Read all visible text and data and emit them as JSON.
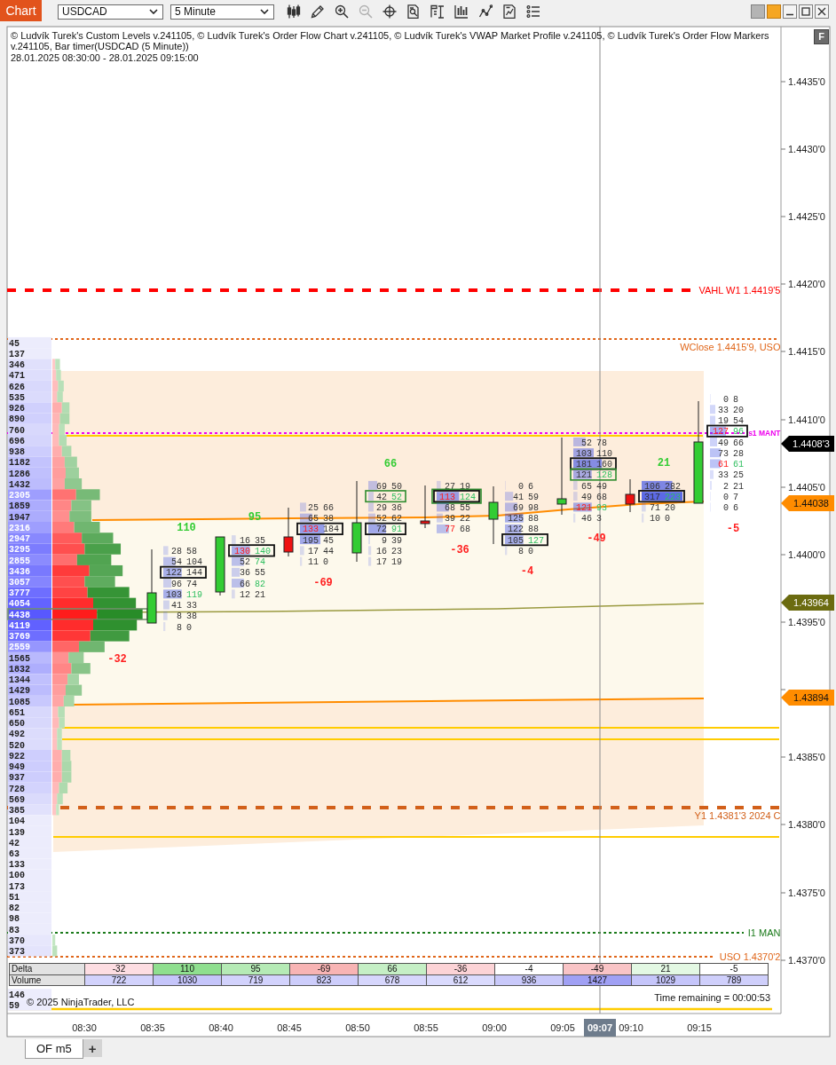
{
  "toolbar": {
    "title": "Chart",
    "instrument": "USDCAD",
    "interval": "5 Minute",
    "tools": [
      {
        "kind": "candlestick",
        "disabled": false
      },
      {
        "kind": "pencil",
        "disabled": false
      },
      {
        "kind": "zoom-in",
        "disabled": false
      },
      {
        "kind": "zoom-out",
        "disabled": true
      },
      {
        "kind": "crosshair",
        "disabled": false
      },
      {
        "kind": "search-document",
        "disabled": false
      },
      {
        "kind": "properties",
        "disabled": false
      },
      {
        "kind": "bars",
        "disabled": false
      },
      {
        "kind": "line",
        "disabled": false
      },
      {
        "kind": "document-chart",
        "disabled": false
      },
      {
        "kind": "list",
        "disabled": false
      }
    ]
  },
  "chart": {
    "header": "© Ludvík Turek's Custom Levels v.241105, © Ludvík Turek's Order Flow Chart v.241105, © Ludvík Turek's VWAP Market Profile v.241105, © Ludvík Turek's Order Flow Markers v.241105, Bar timer(USDCAD (5 Minute))",
    "date_range": "28.01.2025 08:30:00 - 28.01.2025 09:15:00",
    "f_button": "F",
    "price_axis": [
      "1.4435'0",
      "1.4430'0",
      "1.4425'0",
      "1.4420'0",
      "1.4415'0",
      "1.4410'0",
      "1.4405'0",
      "1.4400'0",
      "1.4395'0",
      "1.4385'0",
      "1.4380'0",
      "1.4375'0",
      "1.4370'0"
    ],
    "price_markers": [
      {
        "text": "1.4408'3",
        "color": "#000000"
      },
      {
        "text": "1.44038",
        "color": "#ff8c00"
      },
      {
        "text": "1.43964",
        "color": "#6b6b10"
      },
      {
        "text": "1.43894",
        "color": "#ff8c00"
      }
    ],
    "levels": [
      {
        "label": "VAHL W1 1.4419'5",
        "color": "#ff0000",
        "kind": "dashed"
      },
      {
        "label": "WClose 1.4415'9, USO",
        "color": "#e0661a",
        "kind": "dotted"
      },
      {
        "label": "s1 MANT",
        "color": "#ee00ee",
        "kind": "dotted"
      },
      {
        "label": "Y1 1.4381'3 2024 C",
        "color": "#d2601a",
        "kind": "dashed"
      },
      {
        "label": "I1 MAN",
        "color": "#1a7a1a",
        "kind": "dotted"
      },
      {
        "label": "USO 1.4370'2",
        "color": "#e0661a",
        "kind": "dotted"
      }
    ],
    "profile": {
      "rows": [
        {
          "volume": "45",
          "poc": false
        },
        {
          "volume": "137",
          "poc": false
        },
        {
          "volume": "346",
          "bid": {
            "level": 0.03
          },
          "ask": {
            "level": 0.05
          },
          "poc": false
        },
        {
          "volume": "471",
          "bid": {
            "level": 0.04
          },
          "ask": {
            "level": 0.05
          },
          "poc": false
        },
        {
          "volume": "626",
          "bid": {
            "level": 0.06
          },
          "ask": {
            "level": 0.06
          },
          "poc": false
        },
        {
          "volume": "535",
          "bid": {
            "level": 0.05
          },
          "ask": {
            "level": 0.06
          },
          "poc": false
        },
        {
          "volume": "926",
          "bid": {
            "level": 0.1
          },
          "ask": {
            "level": 0.08
          },
          "poc": false
        },
        {
          "volume": "890",
          "bid": {
            "level": 0.08
          },
          "ask": {
            "level": 0.1
          },
          "poc": false
        },
        {
          "volume": "760",
          "bid": {
            "level": 0.07
          },
          "ask": {
            "level": 0.06
          },
          "poc": false
        },
        {
          "volume": "696",
          "bid": {
            "level": 0.07
          },
          "ask": {
            "level": 0.08
          },
          "poc": false
        },
        {
          "volume": "938",
          "bid": {
            "level": 0.1
          },
          "ask": {
            "level": 0.1
          },
          "poc": false
        },
        {
          "volume": "1182",
          "bid": {
            "level": 0.13
          },
          "ask": {
            "level": 0.13
          },
          "poc": false
        },
        {
          "volume": "1286",
          "bid": {
            "level": 0.14
          },
          "ask": {
            "level": 0.14
          },
          "poc": false
        },
        {
          "volume": "1432",
          "bid": {
            "level": 0.13
          },
          "ask": {
            "level": 0.18
          },
          "poc": false
        },
        {
          "volume": "2305",
          "bid": {
            "level": 0.25
          },
          "ask": {
            "level": 0.25
          },
          "poc": false
        },
        {
          "volume": "1859",
          "bid": {
            "level": 0.2
          },
          "ask": {
            "level": 0.21
          },
          "poc": false
        },
        {
          "volume": "1947",
          "bid": {
            "level": 0.18
          },
          "ask": {
            "level": 0.23
          },
          "poc": false
        },
        {
          "volume": "2316",
          "bid": {
            "level": 0.23
          },
          "ask": {
            "level": 0.27
          },
          "poc": false
        },
        {
          "volume": "2947",
          "bid": {
            "level": 0.31
          },
          "ask": {
            "level": 0.33
          },
          "poc": false
        },
        {
          "volume": "3295",
          "bid": {
            "level": 0.34
          },
          "ask": {
            "level": 0.38
          },
          "poc": false
        },
        {
          "volume": "2855",
          "bid": {
            "level": 0.26
          },
          "ask": {
            "level": 0.36
          },
          "poc": false
        },
        {
          "volume": "3436",
          "bid": {
            "level": 0.39
          },
          "ask": {
            "level": 0.35
          },
          "poc": false
        },
        {
          "volume": "3057",
          "bid": {
            "level": 0.34
          },
          "ask": {
            "level": 0.32
          },
          "poc": false
        },
        {
          "volume": "3777",
          "bid": {
            "level": 0.37
          },
          "ask": {
            "level": 0.44
          },
          "poc": false
        },
        {
          "volume": "4054",
          "bid": {
            "level": 0.43
          },
          "ask": {
            "level": 0.45
          },
          "poc": false
        },
        {
          "volume": "4438",
          "bid": {
            "level": 0.47
          },
          "ask": {
            "level": 0.48
          },
          "poc": true
        },
        {
          "volume": "4119",
          "bid": {
            "level": 0.43
          },
          "ask": {
            "level": 0.46
          },
          "poc": false
        },
        {
          "volume": "3769",
          "bid": {
            "level": 0.4
          },
          "ask": {
            "level": 0.41
          },
          "poc": false
        },
        {
          "volume": "2559",
          "bid": {
            "level": 0.28
          },
          "ask": {
            "level": 0.27
          },
          "poc": false
        },
        {
          "volume": "1565",
          "bid": {
            "level": 0.17
          },
          "ask": {
            "level": 0.16
          },
          "poc": false
        },
        {
          "volume": "1832",
          "bid": {
            "level": 0.2
          },
          "ask": {
            "level": 0.2
          },
          "poc": false
        },
        {
          "volume": "1344",
          "bid": {
            "level": 0.16
          },
          "ask": {
            "level": 0.12
          },
          "poc": false
        },
        {
          "volume": "1429",
          "bid": {
            "level": 0.14
          },
          "ask": {
            "level": 0.17
          },
          "poc": false
        },
        {
          "volume": "1085",
          "bid": {
            "level": 0.12
          },
          "ask": {
            "level": 0.11
          },
          "poc": false
        },
        {
          "volume": "651",
          "bid": {
            "level": 0.06
          },
          "ask": {
            "level": 0.07
          },
          "poc": false
        },
        {
          "volume": "650",
          "bid": {
            "level": 0.07
          },
          "ask": {
            "level": 0.06
          },
          "poc": false
        },
        {
          "volume": "492",
          "bid": {
            "level": 0.05
          },
          "ask": {
            "level": 0.05
          },
          "poc": false
        },
        {
          "volume": "520",
          "bid": {
            "level": 0.05
          },
          "ask": {
            "level": 0.05
          },
          "poc": false
        },
        {
          "volume": "922",
          "bid": {
            "level": 0.1
          },
          "ask": {
            "level": 0.09
          },
          "poc": false
        },
        {
          "volume": "949",
          "bid": {
            "level": 0.1
          },
          "ask": {
            "level": 0.1
          },
          "poc": false
        },
        {
          "volume": "937",
          "bid": {
            "level": 0.1
          },
          "ask": {
            "level": 0.1
          },
          "poc": false
        },
        {
          "volume": "728",
          "bid": {
            "level": 0.07
          },
          "ask": {
            "level": 0.09
          },
          "poc": false
        },
        {
          "volume": "569",
          "bid": {
            "level": 0.05
          },
          "ask": {
            "level": 0.06
          },
          "poc": false
        },
        {
          "volume": "385",
          "bid": {
            "level": 0.04
          },
          "ask": {
            "level": 0.03
          },
          "poc": false
        },
        {
          "volume": "104",
          "poc": false
        },
        {
          "volume": "139",
          "poc": false
        },
        {
          "volume": "42",
          "poc": false
        },
        {
          "volume": "63",
          "poc": false
        },
        {
          "volume": "133",
          "poc": false
        },
        {
          "volume": "100",
          "poc": false
        },
        {
          "volume": "173",
          "poc": false
        },
        {
          "volume": "51",
          "poc": false
        },
        {
          "volume": "82",
          "poc": false
        },
        {
          "volume": "98",
          "poc": false
        },
        {
          "volume": "83",
          "poc": false
        },
        {
          "volume": "370",
          "ask": {
            "level": 0.03
          },
          "poc": false
        },
        {
          "volume": "373",
          "ask": {
            "level": 0.05
          },
          "poc": false
        }
      ],
      "lower_rows": [
        {
          "volume": "146",
          "poc": false
        },
        {
          "volume": "59",
          "poc": false
        }
      ]
    },
    "bars": [
      {
        "delta": {
          "text": "-32",
          "color": "#ff2020"
        }
      },
      {
        "rising": true,
        "delta": {
          "text": "110",
          "color": "#33cc33"
        },
        "rows": [
          {
            "bid": "28",
            "ask": "58",
            "level": 0.12,
            "bid_imbalance": false,
            "ask_imbalance": false,
            "poc": false,
            "marked": false
          },
          {
            "bid": "54",
            "ask": "104",
            "level": 0.3,
            "bid_imbalance": false,
            "ask_imbalance": false,
            "poc": false,
            "marked": false
          },
          {
            "bid": "122",
            "ask": "144",
            "level": 0.45,
            "bid_imbalance": false,
            "ask_imbalance": false,
            "poc": true,
            "marked": false
          },
          {
            "bid": "96",
            "ask": "74",
            "level": 0.2,
            "bid_imbalance": false,
            "ask_imbalance": false,
            "poc": false,
            "marked": false
          },
          {
            "bid": "103",
            "ask": "119",
            "level": 0.45,
            "bid_imbalance": false,
            "ask_imbalance": true,
            "poc": false,
            "marked": false
          },
          {
            "bid": "41",
            "ask": "33",
            "level": 0.15,
            "bid_imbalance": false,
            "ask_imbalance": false,
            "poc": false,
            "marked": false
          },
          {
            "bid": "8",
            "ask": "38",
            "level": 0.1,
            "bid_imbalance": false,
            "ask_imbalance": false,
            "poc": false,
            "marked": false
          },
          {
            "bid": "8",
            "ask": "0",
            "level": 0.05,
            "bid_imbalance": false,
            "ask_imbalance": false,
            "poc": false,
            "marked": false
          }
        ]
      },
      {
        "rising": true,
        "delta": {
          "text": "95",
          "color": "#33cc33"
        },
        "rows": [
          {
            "bid": "16",
            "ask": "35",
            "level": 0.1,
            "bid_imbalance": false,
            "ask_imbalance": false,
            "poc": false,
            "marked": false
          },
          {
            "bid": "130",
            "ask": "140",
            "level": 0.45,
            "bid_imbalance": true,
            "ask_imbalance": true,
            "poc": true,
            "marked": false
          },
          {
            "bid": "52",
            "ask": "74",
            "level": 0.3,
            "bid_imbalance": false,
            "ask_imbalance": true,
            "poc": false,
            "marked": false
          },
          {
            "bid": "36",
            "ask": "55",
            "level": 0.2,
            "bid_imbalance": false,
            "ask_imbalance": false,
            "poc": false,
            "marked": false
          },
          {
            "bid": "66",
            "ask": "82",
            "level": 0.3,
            "bid_imbalance": false,
            "ask_imbalance": true,
            "poc": false,
            "marked": false
          },
          {
            "bid": "12",
            "ask": "21",
            "level": 0.08,
            "bid_imbalance": false,
            "ask_imbalance": false,
            "poc": false,
            "marked": false
          }
        ]
      },
      {
        "rising": false,
        "delta": {
          "text": "-69",
          "color": "#ff2020"
        },
        "rows": [
          {
            "bid": "25",
            "ask": "66",
            "level": 0.15,
            "bid_imbalance": false,
            "ask_imbalance": false,
            "poc": false,
            "marked": false
          },
          {
            "bid": "65",
            "ask": "38",
            "level": 0.3,
            "bid_imbalance": false,
            "ask_imbalance": false,
            "poc": false,
            "marked": false
          },
          {
            "bid": "133",
            "ask": "184",
            "level": 0.6,
            "bid_imbalance": true,
            "ask_imbalance": false,
            "poc": true,
            "marked": false
          },
          {
            "bid": "195",
            "ask": "45",
            "level": 0.5,
            "bid_imbalance": false,
            "ask_imbalance": false,
            "poc": false,
            "marked": false
          },
          {
            "bid": "17",
            "ask": "44",
            "level": 0.1,
            "bid_imbalance": false,
            "ask_imbalance": false,
            "poc": false,
            "marked": false
          },
          {
            "bid": "11",
            "ask": "0",
            "level": 0.05,
            "bid_imbalance": false,
            "ask_imbalance": false,
            "poc": false,
            "marked": false
          }
        ]
      },
      {
        "rising": true,
        "delta": {
          "text": "66",
          "color": "#33cc33"
        },
        "rows": [
          {
            "bid": "69",
            "ask": "50",
            "level": 0.25,
            "bid_imbalance": false,
            "ask_imbalance": false,
            "poc": false,
            "marked": false
          },
          {
            "bid": "42",
            "ask": "52",
            "level": 0.15,
            "bid_imbalance": false,
            "ask_imbalance": true,
            "poc": false,
            "marked": true
          },
          {
            "bid": "29",
            "ask": "36",
            "level": 0.15,
            "bid_imbalance": false,
            "ask_imbalance": false,
            "poc": false,
            "marked": false
          },
          {
            "bid": "52",
            "ask": "62",
            "level": 0.2,
            "bid_imbalance": false,
            "ask_imbalance": false,
            "poc": false,
            "marked": false
          },
          {
            "bid": "72",
            "ask": "91",
            "level": 0.5,
            "bid_imbalance": false,
            "ask_imbalance": true,
            "poc": true,
            "marked": false
          },
          {
            "bid": "9",
            "ask": "39",
            "level": 0.05,
            "bid_imbalance": false,
            "ask_imbalance": false,
            "poc": false,
            "marked": false
          },
          {
            "bid": "16",
            "ask": "23",
            "level": 0.08,
            "bid_imbalance": false,
            "ask_imbalance": false,
            "poc": false,
            "marked": false
          },
          {
            "bid": "17",
            "ask": "19",
            "level": 0.08,
            "bid_imbalance": false,
            "ask_imbalance": false,
            "poc": false,
            "marked": false
          }
        ]
      },
      {
        "rising": false,
        "delta": {
          "text": "-36",
          "color": "#ff2020"
        },
        "rows": [
          {
            "bid": "27",
            "ask": "19",
            "level": 0.1,
            "bid_imbalance": false,
            "ask_imbalance": false,
            "poc": false,
            "marked": false
          },
          {
            "bid": "113",
            "ask": "124",
            "level": 0.55,
            "bid_imbalance": true,
            "ask_imbalance": true,
            "poc": true,
            "marked": true
          },
          {
            "bid": "68",
            "ask": "55",
            "level": 0.3,
            "bid_imbalance": false,
            "ask_imbalance": false,
            "poc": false,
            "marked": false
          },
          {
            "bid": "39",
            "ask": "22",
            "level": 0.15,
            "bid_imbalance": false,
            "ask_imbalance": false,
            "poc": false,
            "marked": false
          },
          {
            "bid": "77",
            "ask": "68",
            "level": 0.3,
            "bid_imbalance": true,
            "ask_imbalance": false,
            "poc": false,
            "marked": false
          }
        ]
      },
      {
        "rising": true,
        "delta": {
          "text": "-4",
          "color": "#ff2020"
        },
        "rows": [
          {
            "bid": "0",
            "ask": "6",
            "level": 0.02,
            "bid_imbalance": false,
            "ask_imbalance": false,
            "poc": false,
            "marked": false
          },
          {
            "bid": "41",
            "ask": "59",
            "level": 0.2,
            "bid_imbalance": false,
            "ask_imbalance": false,
            "poc": false,
            "marked": false
          },
          {
            "bid": "69",
            "ask": "98",
            "level": 0.3,
            "bid_imbalance": false,
            "ask_imbalance": false,
            "poc": false,
            "marked": false
          },
          {
            "bid": "125",
            "ask": "88",
            "level": 0.45,
            "bid_imbalance": false,
            "ask_imbalance": false,
            "poc": false,
            "marked": false
          },
          {
            "bid": "122",
            "ask": "88",
            "level": 0.4,
            "bid_imbalance": false,
            "ask_imbalance": false,
            "poc": false,
            "marked": false
          },
          {
            "bid": "105",
            "ask": "127",
            "level": 0.45,
            "bid_imbalance": false,
            "ask_imbalance": true,
            "poc": true,
            "marked": false
          },
          {
            "bid": "8",
            "ask": "0",
            "level": 0.05,
            "bid_imbalance": false,
            "ask_imbalance": false,
            "poc": false,
            "marked": false
          }
        ]
      },
      {
        "rising": true,
        "delta": {
          "text": "-49",
          "color": "#ff2020"
        },
        "rows": [
          {
            "bid": "52",
            "ask": "78",
            "level": 0.3,
            "bid_imbalance": false,
            "ask_imbalance": false,
            "poc": false,
            "marked": false
          },
          {
            "bid": "103",
            "ask": "110",
            "level": 0.5,
            "bid_imbalance": false,
            "ask_imbalance": false,
            "poc": false,
            "marked": false
          },
          {
            "bid": "181",
            "ask": "160",
            "level": 0.7,
            "bid_imbalance": false,
            "ask_imbalance": false,
            "poc": true,
            "marked": false
          },
          {
            "bid": "121",
            "ask": "128",
            "level": 0.45,
            "bid_imbalance": false,
            "ask_imbalance": true,
            "poc": false,
            "marked": true
          },
          {
            "bid": "65",
            "ask": "49",
            "level": 0.1,
            "bid_imbalance": false,
            "ask_imbalance": false,
            "poc": false,
            "marked": false
          },
          {
            "bid": "49",
            "ask": "68",
            "level": 0.1,
            "bid_imbalance": false,
            "ask_imbalance": false,
            "poc": false,
            "marked": false
          },
          {
            "bid": "121",
            "ask": "93",
            "level": 0.45,
            "bid_imbalance": true,
            "ask_imbalance": true,
            "poc": false,
            "marked": false
          },
          {
            "bid": "46",
            "ask": "3",
            "level": 0.05,
            "bid_imbalance": false,
            "ask_imbalance": false,
            "poc": false,
            "marked": false
          }
        ]
      },
      {
        "rising": false,
        "delta": {
          "text": "21",
          "color": "#33cc33"
        },
        "rows": [
          {
            "bid": "106",
            "ask": "282",
            "level": 0.75,
            "bid_imbalance": false,
            "ask_imbalance": false,
            "poc": false,
            "marked": false
          },
          {
            "bid": "317",
            "ask": "223",
            "level": 1,
            "bid_imbalance": false,
            "ask_imbalance": true,
            "poc": true,
            "marked": false
          },
          {
            "bid": "71",
            "ask": "20",
            "level": 0.1,
            "bid_imbalance": false,
            "ask_imbalance": false,
            "poc": false,
            "marked": false
          },
          {
            "bid": "10",
            "ask": "0",
            "level": 0.05,
            "bid_imbalance": false,
            "ask_imbalance": false,
            "poc": false,
            "marked": false
          }
        ]
      },
      {
        "rising": true,
        "delta": {
          "text": "-5",
          "color": "#ff2020"
        },
        "rows": [
          {
            "bid": "0",
            "ask": "8",
            "level": 0.02,
            "bid_imbalance": false,
            "ask_imbalance": false,
            "poc": false,
            "marked": false
          },
          {
            "bid": "33",
            "ask": "20",
            "level": 0.15,
            "bid_imbalance": false,
            "ask_imbalance": false,
            "poc": false,
            "marked": false
          },
          {
            "bid": "19",
            "ask": "54",
            "level": 0.15,
            "bid_imbalance": false,
            "ask_imbalance": false,
            "poc": false,
            "marked": false
          },
          {
            "bid": "127",
            "ask": "96",
            "level": 0.45,
            "bid_imbalance": true,
            "ask_imbalance": true,
            "poc": true,
            "marked": false
          },
          {
            "bid": "49",
            "ask": "66",
            "level": 0.2,
            "bid_imbalance": false,
            "ask_imbalance": false,
            "poc": false,
            "marked": false
          },
          {
            "bid": "73",
            "ask": "28",
            "level": 0.3,
            "bid_imbalance": false,
            "ask_imbalance": false,
            "poc": false,
            "marked": false
          },
          {
            "bid": "61",
            "ask": "61",
            "level": 0.3,
            "bid_imbalance": true,
            "ask_imbalance": true,
            "poc": false,
            "marked": false
          },
          {
            "bid": "33",
            "ask": "25",
            "level": 0.1,
            "bid_imbalance": false,
            "ask_imbalance": false,
            "poc": false,
            "marked": false
          },
          {
            "bid": "2",
            "ask": "21",
            "level": 0.05,
            "bid_imbalance": false,
            "ask_imbalance": false,
            "poc": false,
            "marked": false
          },
          {
            "bid": "0",
            "ask": "7",
            "level": 0.02,
            "bid_imbalance": false,
            "ask_imbalance": false,
            "poc": false,
            "marked": false
          },
          {
            "bid": "0",
            "ask": "6",
            "level": 0.02,
            "bid_imbalance": false,
            "ask_imbalance": false,
            "poc": false,
            "marked": false
          }
        ]
      }
    ],
    "crosshair_time": "09:07",
    "time_axis": [
      "08:30",
      "08:35",
      "08:40",
      "08:45",
      "08:50",
      "08:55",
      "09:00",
      "09:05",
      "09:10",
      "09:15"
    ],
    "summary_table": {
      "rows": [
        {
          "label": "Delta",
          "cells": [
            {
              "text": "-32",
              "color": "#fddde2"
            },
            {
              "text": "110",
              "color": "#8fdf8f"
            },
            {
              "text": "95",
              "color": "#b5eab5"
            },
            {
              "text": "-69",
              "color": "#f8b4b4"
            },
            {
              "text": "66",
              "color": "#c5efc5"
            },
            {
              "text": "-36",
              "color": "#fcd3d6"
            },
            {
              "text": "-4",
              "color": "#ffffff"
            },
            {
              "text": "-49",
              "color": "#f9c4c6"
            },
            {
              "text": "21",
              "color": "#e3f8e3"
            },
            {
              "text": "-5",
              "color": "#ffffff"
            }
          ]
        },
        {
          "label": "Volume",
          "cells": [
            {
              "text": "722",
              "color": "#d2d2fc"
            },
            {
              "text": "1030",
              "color": "#c5c5fa"
            },
            {
              "text": "719",
              "color": "#d2d2fc"
            },
            {
              "text": "823",
              "color": "#cdcdfb"
            },
            {
              "text": "678",
              "color": "#d6d6fc"
            },
            {
              "text": "612",
              "color": "#dadafd"
            },
            {
              "text": "936",
              "color": "#c9c9fa"
            },
            {
              "text": "1427",
              "color": "#a0a0f4"
            },
            {
              "text": "1029",
              "color": "#c5c5fa"
            },
            {
              "text": "789",
              "color": "#cfcffb"
            }
          ]
        }
      ]
    },
    "copyright": "© 2025 NinjaTrader, LLC",
    "time_remaining": "Time remaining = 00:00:53"
  },
  "tabs": [
    {
      "label": "OF m5",
      "selected": true
    }
  ],
  "add_tab": "+"
}
